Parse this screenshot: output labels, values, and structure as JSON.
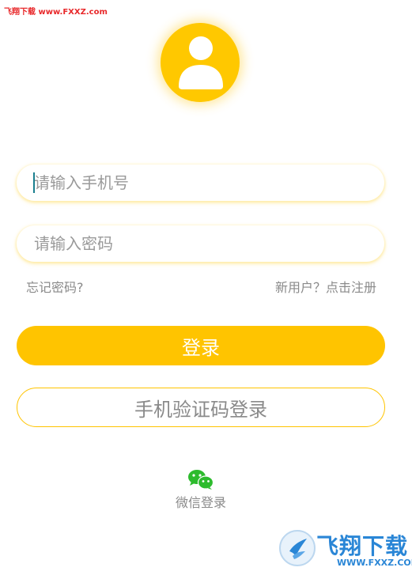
{
  "watermark": {
    "top_text": "飞翔下载 www.FXXZ.com",
    "logo_text": "飞翔下载",
    "logo_url": "WWW.FXXZ.COM"
  },
  "avatar": {
    "icon": "user-avatar-icon",
    "bg_color": "#ffc800"
  },
  "form": {
    "phone_placeholder": "请输入手机号",
    "phone_value": "",
    "password_placeholder": "请输入密码",
    "password_value": ""
  },
  "links": {
    "forgot_password": "忘记密码?",
    "register": "新用户？点击注册"
  },
  "buttons": {
    "login": "登录",
    "sms_login": "手机验证码登录"
  },
  "social": {
    "wechat_icon": "wechat-icon",
    "wechat_label": "微信登录",
    "wechat_color": "#2dbb2d"
  },
  "colors": {
    "accent": "#ffc400",
    "text_muted": "#8a8a8a"
  }
}
